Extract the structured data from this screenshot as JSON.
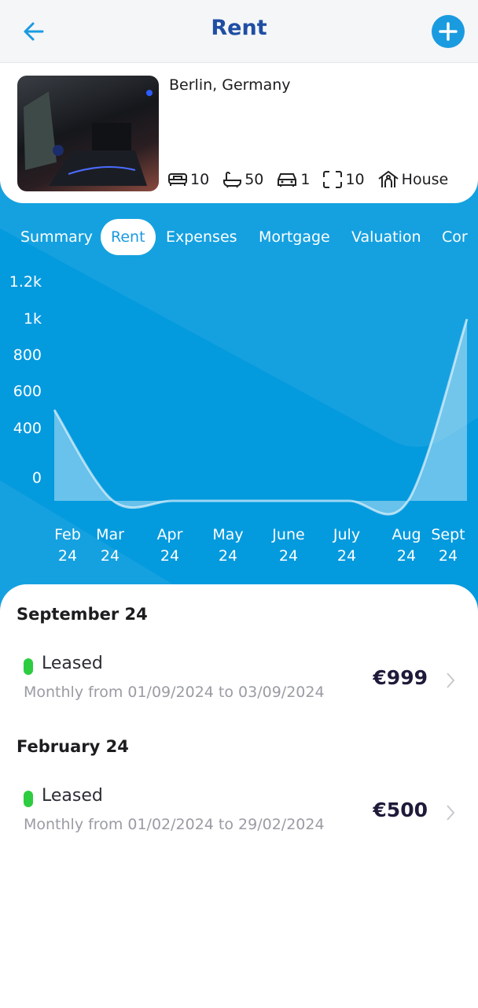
{
  "header": {
    "title": "Rent",
    "back_icon": "arrow-left-icon",
    "add_icon": "plus-icon"
  },
  "property": {
    "location": "Berlin, Germany",
    "features": [
      {
        "icon": "bed-icon",
        "value": "10"
      },
      {
        "icon": "bathtub-icon",
        "value": "50"
      },
      {
        "icon": "car-icon",
        "value": "1"
      },
      {
        "icon": "area-icon",
        "value": "10"
      },
      {
        "icon": "house-icon",
        "value": "House"
      }
    ]
  },
  "tabs": [
    {
      "label": "Summary"
    },
    {
      "label": "Rent",
      "active": true
    },
    {
      "label": "Expenses"
    },
    {
      "label": "Mortgage"
    },
    {
      "label": "Valuation"
    },
    {
      "label": "Cor"
    }
  ],
  "colors": {
    "accent": "#1a9be0",
    "title": "#1f4ea3",
    "chart_bg": "#049ade",
    "leased": "#2ecc40"
  },
  "chart_data": {
    "type": "area",
    "categories": [
      "Feb 24",
      "Mar 24",
      "Apr 24",
      "May 24",
      "June 24",
      "July 24",
      "Aug 24",
      "Sept 24"
    ],
    "x_labels": [
      [
        "Feb",
        "24"
      ],
      [
        "Mar",
        "24"
      ],
      [
        "Apr",
        "24"
      ],
      [
        "May",
        "24"
      ],
      [
        "June",
        "24"
      ],
      [
        "July",
        "24"
      ],
      [
        "Aug",
        "24"
      ],
      [
        "Sept",
        "24"
      ]
    ],
    "values": [
      500,
      0,
      0,
      0,
      0,
      0,
      0,
      999
    ],
    "y_ticks": [
      "1.2k",
      "1k",
      "800",
      "600",
      "400",
      "0"
    ],
    "grid": false
  },
  "entries": [
    {
      "month": "September 24",
      "status": "Leased",
      "range": "Monthly from 01/09/2024 to 03/09/2024",
      "amount": "€999"
    },
    {
      "month": "February 24",
      "status": "Leased",
      "range": "Monthly from 01/02/2024 to 29/02/2024",
      "amount": "€500"
    }
  ]
}
